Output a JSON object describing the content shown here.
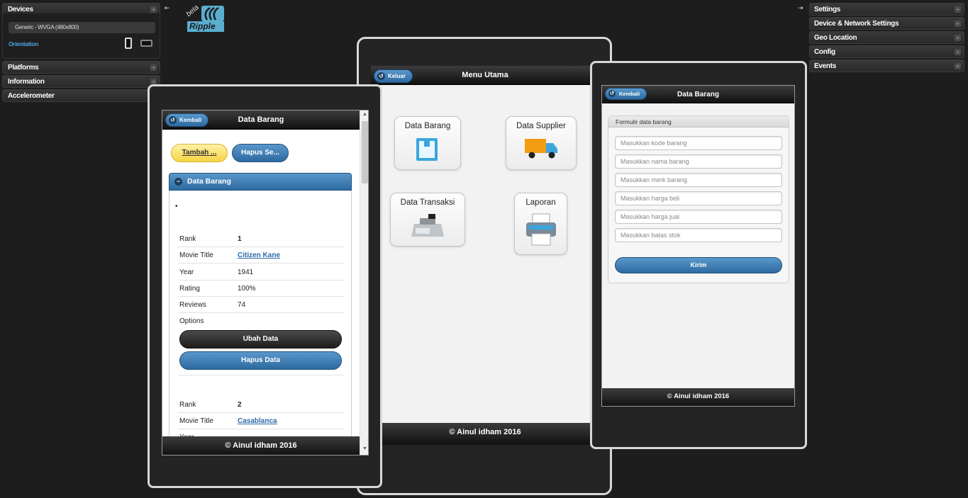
{
  "left_panel": {
    "devices": {
      "title": "Devices",
      "device_select": "Generic - WVGA (480x800)",
      "orientation_label": "Orientation"
    },
    "sections": [
      "Platforms",
      "Information",
      "Accelerometer"
    ]
  },
  "right_panel": {
    "sections": [
      "Settings",
      "Device & Network Settings",
      "Geo Location",
      "Config",
      "Events"
    ]
  },
  "logo": {
    "badge": "beta",
    "name": "Ripple"
  },
  "menu_screen": {
    "back_label": "Keluar",
    "title": "Menu Utama",
    "tiles": [
      "Data Barang",
      "Data Supplier",
      "Data Transaksi",
      "Laporan"
    ],
    "footer": "© Ainul idham 2016"
  },
  "list_screen": {
    "back_label": "Kembali",
    "title": "Data Barang",
    "add_button": "Tambah ...",
    "delete_selected_button": "Hapus Se...",
    "collapsible_title": "Data Barang",
    "bullet": "•",
    "record1": {
      "rank_label": "Rank",
      "rank": "1",
      "title_label": "Movie Title",
      "title": "Citizen Kane",
      "year_label": "Year",
      "year": "1941",
      "rating_label": "Rating",
      "rating": "100%",
      "reviews_label": "Reviews",
      "reviews": "74",
      "options_label": "Options"
    },
    "edit_button": "Ubah Data",
    "delete_button": "Hapus Data",
    "record2": {
      "rank_label": "Rank",
      "rank": "2",
      "title_label": "Movie Title",
      "title": "Casablanca",
      "year_label": "Year"
    },
    "footer": "© Ainul idham 2016"
  },
  "form_screen": {
    "back_label": "Kembali",
    "title": "Data Barang",
    "form_title": "Formulir data barang",
    "placeholders": [
      "Masukkan kode barang",
      "Masukkan nama barang",
      "Masukkan merk barang",
      "Masukkan harga beli",
      "Masukkan harga jual",
      "Masukkan batas stok"
    ],
    "submit": "Kirim",
    "footer": "© Ainul idham 2016"
  },
  "colors": {
    "accent_blue": "#3a78b4",
    "link_blue": "#4aa4e0",
    "yellow_button": "#fbe57a",
    "dark_bg": "#1d1d1d"
  }
}
